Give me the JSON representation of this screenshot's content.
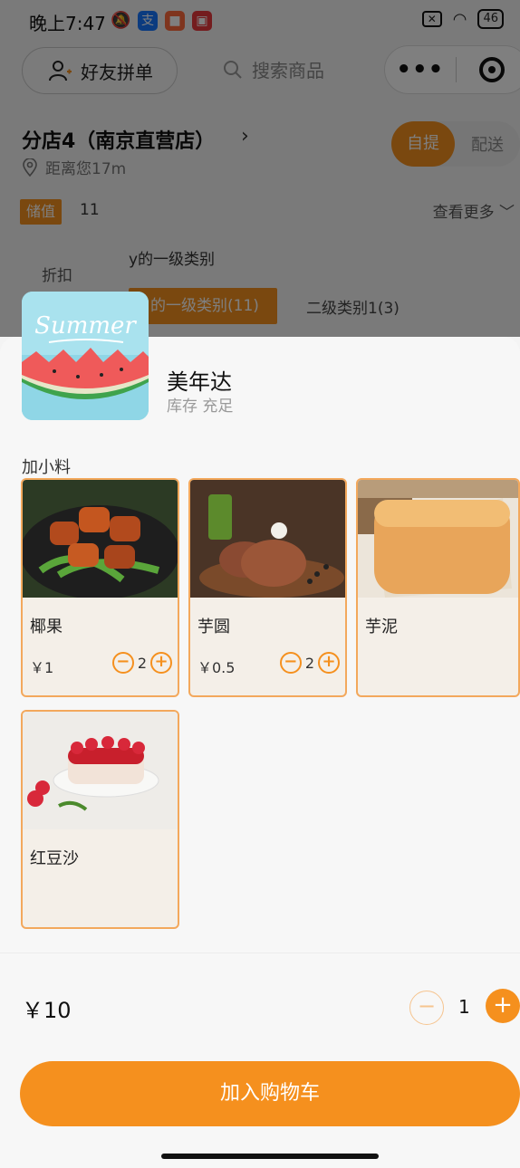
{
  "status_bar": {
    "time": "晚上7:47",
    "battery": "46"
  },
  "header": {
    "friend_order": "好友拼单",
    "search_placeholder": "搜索商品",
    "more_dots": "•••"
  },
  "store": {
    "name": "分店4（南京直营店）",
    "chevron": "›",
    "distance": "距离您17m",
    "mode_pickup": "自提",
    "mode_delivery": "配送"
  },
  "promo": {
    "stored_label": "储值",
    "stored_value": "11",
    "see_more": "查看更多 ﹀"
  },
  "categories": {
    "discount": "折扣",
    "level1": "y的一级类别",
    "active_tab": "的一级类别(11)",
    "tab2": "二级类别1(3)"
  },
  "product": {
    "image_text": "Summer",
    "name": "美年达",
    "stock": "库存 充足"
  },
  "addons": {
    "title": "加小料",
    "items": [
      {
        "name": "椰果",
        "price": "￥1",
        "qty": "2"
      },
      {
        "name": "芋圆",
        "price": "￥0.5",
        "qty": "2"
      },
      {
        "name": "芋泥"
      },
      {
        "name": "红豆沙"
      }
    ]
  },
  "footer": {
    "total": "￥10",
    "quantity": "1",
    "add_to_cart": "加入购物车"
  },
  "colors": {
    "accent": "#f5901e",
    "accent_light": "#f6c48f"
  }
}
